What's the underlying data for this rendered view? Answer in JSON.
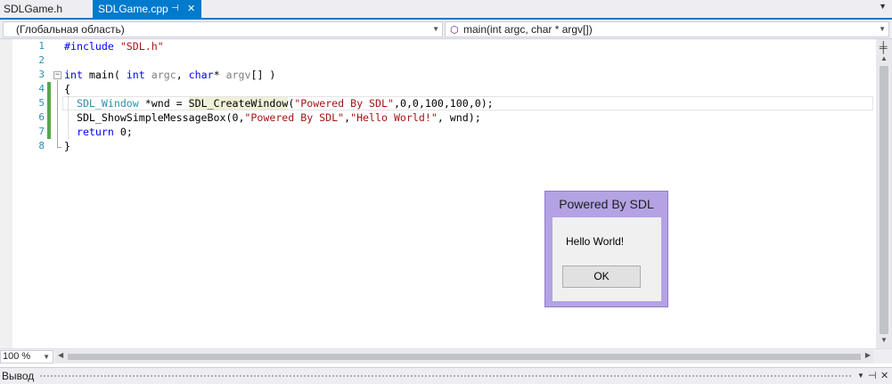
{
  "tabs": [
    {
      "label": "SDLGame.h",
      "active": false
    },
    {
      "label": "SDLGame.cpp",
      "active": true
    }
  ],
  "tab_icons": {
    "pin": "pin-icon",
    "close": "close-icon",
    "dropdown": "chevron-down-icon"
  },
  "navbar": {
    "scope": "(Глобальная область)",
    "member": "main(int argc, char * argv[])"
  },
  "editor": {
    "line_numbers": [
      "1",
      "2",
      "3",
      "4",
      "5",
      "6",
      "7",
      "8"
    ],
    "code_text": [
      "#include \"SDL.h\"",
      "",
      "int main( int argc, char* argv[] )",
      "{",
      "  SDL_Window *wnd = SDL_CreateWindow(\"Powered By SDL\",0,0,100,100,0);",
      "  SDL_ShowSimpleMessageBox(0,\"Powered By SDL\",\"Hello World!\", wnd);",
      "  return 0;",
      "}"
    ]
  },
  "zoom": "100 %",
  "output_panel": {
    "title": "Вывод"
  },
  "message_box": {
    "title": "Powered By SDL",
    "text": "Hello World!",
    "ok_label": "OK"
  },
  "colors": {
    "accent": "#007acc",
    "keyword": "#0000ff",
    "string": "#a31515",
    "type": "#2b91af",
    "change_bar": "#57a64a",
    "msgbox_frame": "#b4a2e4"
  }
}
